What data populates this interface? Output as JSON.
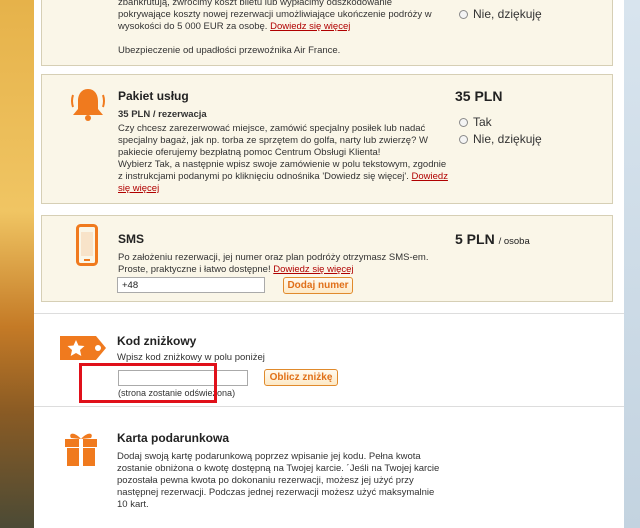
{
  "insurance": {
    "line1": "zbankrutują, zwrócimy koszt biletu lub wypłacimy odszkodowanie",
    "line2": "pokrywające koszty nowej rezerwacji umożliwiające ukończenie podróży w",
    "line3_pre": "wysokości do 5 000 EUR za osobę. ",
    "more_link": "Dowiedz się więcej",
    "note": "Ubezpieczenie od upadłości przewoźnika Air France.",
    "radio_no": "Nie, dziękuję"
  },
  "service_pack": {
    "title": "Pakiet usług",
    "price": "35 PLN",
    "subtitle": "35 PLN / rezerwacja",
    "lines": [
      "Czy chcesz zarezerwować miejsce, zamówić specjalny posiłek lub nadać",
      "specjalny bagaż, jak np. torba ze sprzętem do golfa, narty lub zwierzę? W",
      "pakiecie oferujemy bezpłatną pomoc Centrum Obsługi Klienta!",
      "Wybierz Tak, a następnie wpisz swoje zamówienie w polu tekstowym, zgodnie"
    ],
    "line5_pre": "z instrukcjami podanymi po kliknięciu odnośnika 'Dowiedz się więcej'. ",
    "line5_link": "Dowiedz",
    "line6_link": "się więcej",
    "radio_yes": "Tak",
    "radio_no": "Nie, dziękuję"
  },
  "sms": {
    "title": "SMS",
    "price": "5 PLN",
    "price_unit": "/ osoba",
    "line1": "Po założeniu rezerwacji, jej numer oraz plan podróży otrzymasz SMS-em.",
    "line2_pre": "Proste, praktyczne i łatwo dostępne! ",
    "more_link": "Dowiedz się więcej",
    "phone_value": "+48",
    "add_number_button": "Dodaj numer"
  },
  "discount": {
    "title": "Kod zniżkowy",
    "hint": "Wpisz kod zniżkowy w polu poniżej",
    "code_value": "",
    "refresh_note": "(strona zostanie odświeżona)",
    "calc_button": "Oblicz zniżkę"
  },
  "gift_card": {
    "title": "Karta podarunkowa",
    "lines": [
      "Dodaj swoją kartę podarunkową poprzez wpisanie jej kodu. Pełna kwota",
      "zostanie obniżona o kwotę dostępną na Twojej karcie. ´Jeśli na Twojej karcie",
      "pozostała pewna kwota po dokonaniu rezerwacji, możesz jej użyć przy",
      "następnej rezerwacji. Podczas jednej rezerwacji możesz użyć maksymalnie",
      "10 kart."
    ]
  },
  "colors": {
    "accent": "#f07a1e",
    "link": "#b00000",
    "highlight": "#e0101a",
    "card_bg": "#faf6e8"
  },
  "icons": [
    "bell-icon",
    "phone-icon",
    "discount-tag-icon",
    "gift-icon"
  ]
}
